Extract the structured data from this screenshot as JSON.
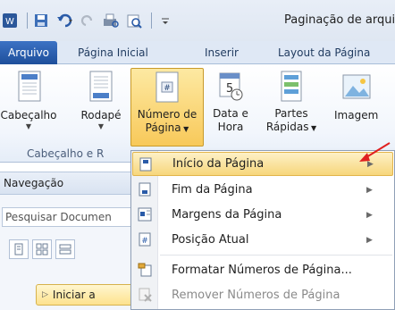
{
  "window": {
    "title": "Paginação de arqui"
  },
  "tabs": {
    "file": "Arquivo",
    "home": "Página Inicial",
    "insert": "Inserir",
    "layout": "Layout da Página"
  },
  "ribbon": {
    "header_label": "Cabeçalho",
    "footer_label": "Rodapé",
    "page_number_line1": "Número de",
    "page_number_line2": "Página",
    "datetime_line1": "Data e",
    "datetime_line2": "Hora",
    "quickparts_line1": "Partes",
    "quickparts_line2": "Rápidas",
    "image_label": "Imagem",
    "group_label": "Cabeçalho e R"
  },
  "nav": {
    "title": "Navegação",
    "search_placeholder": "Pesquisar Documen",
    "start_button": "Iniciar a"
  },
  "menu": {
    "items": [
      {
        "label": "Início da Página"
      },
      {
        "label": "Fim da Página"
      },
      {
        "label": "Margens da Página"
      },
      {
        "label": "Posição Atual"
      },
      {
        "label": "Formatar Números de Página..."
      },
      {
        "label": "Remover Números de Página"
      }
    ]
  },
  "colors": {
    "accent": "#2a5ba8",
    "highlight": "#f7d67b",
    "arrow": "#e02020"
  }
}
